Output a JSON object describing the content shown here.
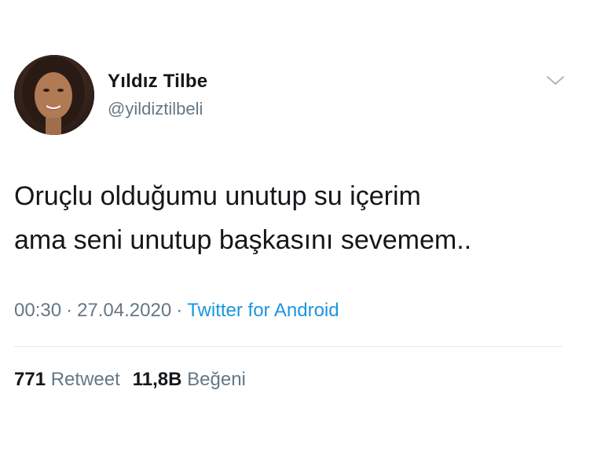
{
  "user": {
    "display_name": "Yıldız Tilbe",
    "handle": "@yildiztilbeli",
    "avatar_icon": "profile-photo"
  },
  "menu_icon": "chevron-down-icon",
  "tweet": {
    "lines": [
      "Oruçlu olduğumu unutup su içerim",
      "ama seni unutup başkasını sevemem.."
    ],
    "time": "00:30",
    "separator": "·",
    "date": "27.04.2020",
    "source": "Twitter for Android"
  },
  "stats": {
    "retweet_count": "771",
    "retweet_label": "Retweet",
    "like_count": "11,8B",
    "like_label": "Beğeni"
  },
  "colors": {
    "text": "#14171a",
    "muted": "#657786",
    "link": "#1b95e0",
    "divider": "#e1e8ed"
  }
}
